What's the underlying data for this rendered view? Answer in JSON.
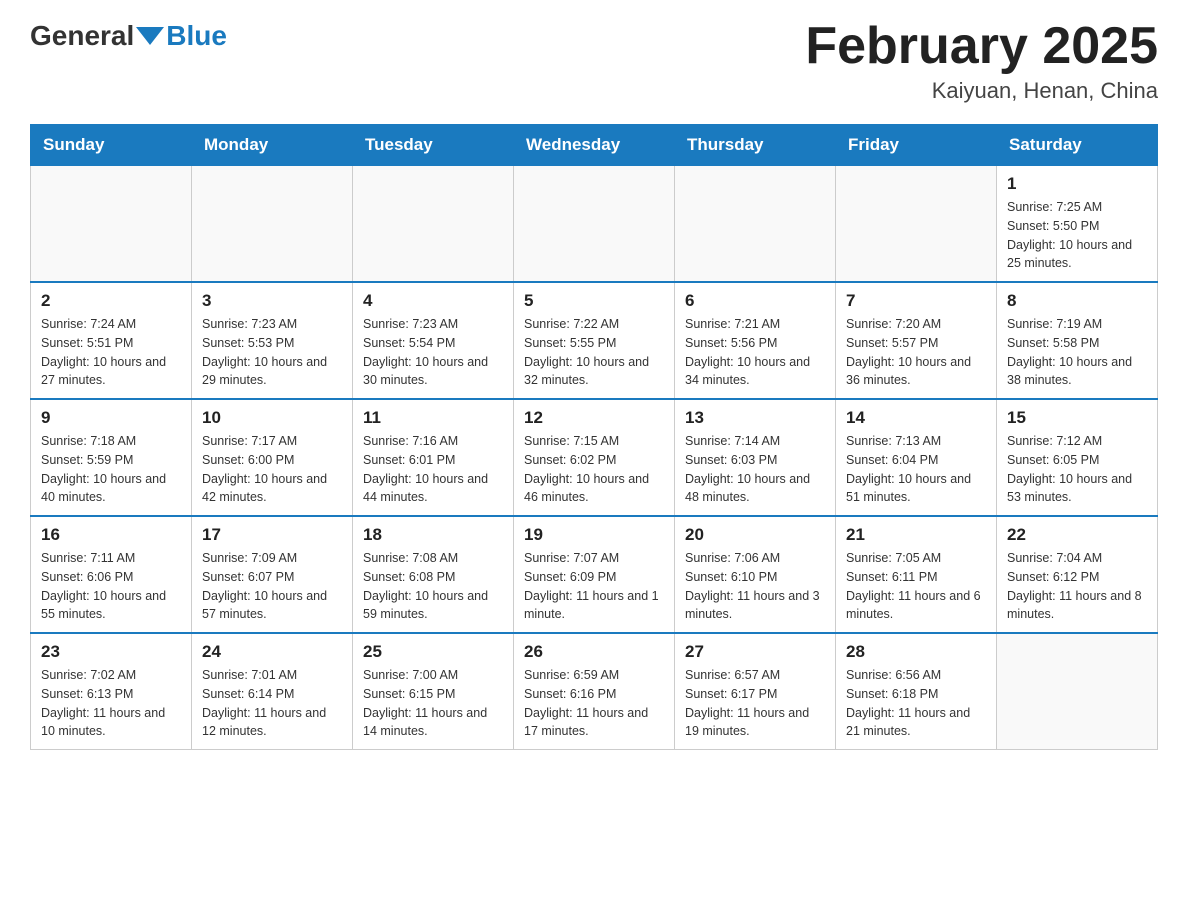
{
  "header": {
    "logo_general": "General",
    "logo_blue": "Blue",
    "month_title": "February 2025",
    "location": "Kaiyuan, Henan, China"
  },
  "days_of_week": [
    "Sunday",
    "Monday",
    "Tuesday",
    "Wednesday",
    "Thursday",
    "Friday",
    "Saturday"
  ],
  "weeks": [
    [
      {
        "day": "",
        "info": ""
      },
      {
        "day": "",
        "info": ""
      },
      {
        "day": "",
        "info": ""
      },
      {
        "day": "",
        "info": ""
      },
      {
        "day": "",
        "info": ""
      },
      {
        "day": "",
        "info": ""
      },
      {
        "day": "1",
        "info": "Sunrise: 7:25 AM\nSunset: 5:50 PM\nDaylight: 10 hours and 25 minutes."
      }
    ],
    [
      {
        "day": "2",
        "info": "Sunrise: 7:24 AM\nSunset: 5:51 PM\nDaylight: 10 hours and 27 minutes."
      },
      {
        "day": "3",
        "info": "Sunrise: 7:23 AM\nSunset: 5:53 PM\nDaylight: 10 hours and 29 minutes."
      },
      {
        "day": "4",
        "info": "Sunrise: 7:23 AM\nSunset: 5:54 PM\nDaylight: 10 hours and 30 minutes."
      },
      {
        "day": "5",
        "info": "Sunrise: 7:22 AM\nSunset: 5:55 PM\nDaylight: 10 hours and 32 minutes."
      },
      {
        "day": "6",
        "info": "Sunrise: 7:21 AM\nSunset: 5:56 PM\nDaylight: 10 hours and 34 minutes."
      },
      {
        "day": "7",
        "info": "Sunrise: 7:20 AM\nSunset: 5:57 PM\nDaylight: 10 hours and 36 minutes."
      },
      {
        "day": "8",
        "info": "Sunrise: 7:19 AM\nSunset: 5:58 PM\nDaylight: 10 hours and 38 minutes."
      }
    ],
    [
      {
        "day": "9",
        "info": "Sunrise: 7:18 AM\nSunset: 5:59 PM\nDaylight: 10 hours and 40 minutes."
      },
      {
        "day": "10",
        "info": "Sunrise: 7:17 AM\nSunset: 6:00 PM\nDaylight: 10 hours and 42 minutes."
      },
      {
        "day": "11",
        "info": "Sunrise: 7:16 AM\nSunset: 6:01 PM\nDaylight: 10 hours and 44 minutes."
      },
      {
        "day": "12",
        "info": "Sunrise: 7:15 AM\nSunset: 6:02 PM\nDaylight: 10 hours and 46 minutes."
      },
      {
        "day": "13",
        "info": "Sunrise: 7:14 AM\nSunset: 6:03 PM\nDaylight: 10 hours and 48 minutes."
      },
      {
        "day": "14",
        "info": "Sunrise: 7:13 AM\nSunset: 6:04 PM\nDaylight: 10 hours and 51 minutes."
      },
      {
        "day": "15",
        "info": "Sunrise: 7:12 AM\nSunset: 6:05 PM\nDaylight: 10 hours and 53 minutes."
      }
    ],
    [
      {
        "day": "16",
        "info": "Sunrise: 7:11 AM\nSunset: 6:06 PM\nDaylight: 10 hours and 55 minutes."
      },
      {
        "day": "17",
        "info": "Sunrise: 7:09 AM\nSunset: 6:07 PM\nDaylight: 10 hours and 57 minutes."
      },
      {
        "day": "18",
        "info": "Sunrise: 7:08 AM\nSunset: 6:08 PM\nDaylight: 10 hours and 59 minutes."
      },
      {
        "day": "19",
        "info": "Sunrise: 7:07 AM\nSunset: 6:09 PM\nDaylight: 11 hours and 1 minute."
      },
      {
        "day": "20",
        "info": "Sunrise: 7:06 AM\nSunset: 6:10 PM\nDaylight: 11 hours and 3 minutes."
      },
      {
        "day": "21",
        "info": "Sunrise: 7:05 AM\nSunset: 6:11 PM\nDaylight: 11 hours and 6 minutes."
      },
      {
        "day": "22",
        "info": "Sunrise: 7:04 AM\nSunset: 6:12 PM\nDaylight: 11 hours and 8 minutes."
      }
    ],
    [
      {
        "day": "23",
        "info": "Sunrise: 7:02 AM\nSunset: 6:13 PM\nDaylight: 11 hours and 10 minutes."
      },
      {
        "day": "24",
        "info": "Sunrise: 7:01 AM\nSunset: 6:14 PM\nDaylight: 11 hours and 12 minutes."
      },
      {
        "day": "25",
        "info": "Sunrise: 7:00 AM\nSunset: 6:15 PM\nDaylight: 11 hours and 14 minutes."
      },
      {
        "day": "26",
        "info": "Sunrise: 6:59 AM\nSunset: 6:16 PM\nDaylight: 11 hours and 17 minutes."
      },
      {
        "day": "27",
        "info": "Sunrise: 6:57 AM\nSunset: 6:17 PM\nDaylight: 11 hours and 19 minutes."
      },
      {
        "day": "28",
        "info": "Sunrise: 6:56 AM\nSunset: 6:18 PM\nDaylight: 11 hours and 21 minutes."
      },
      {
        "day": "",
        "info": ""
      }
    ]
  ]
}
